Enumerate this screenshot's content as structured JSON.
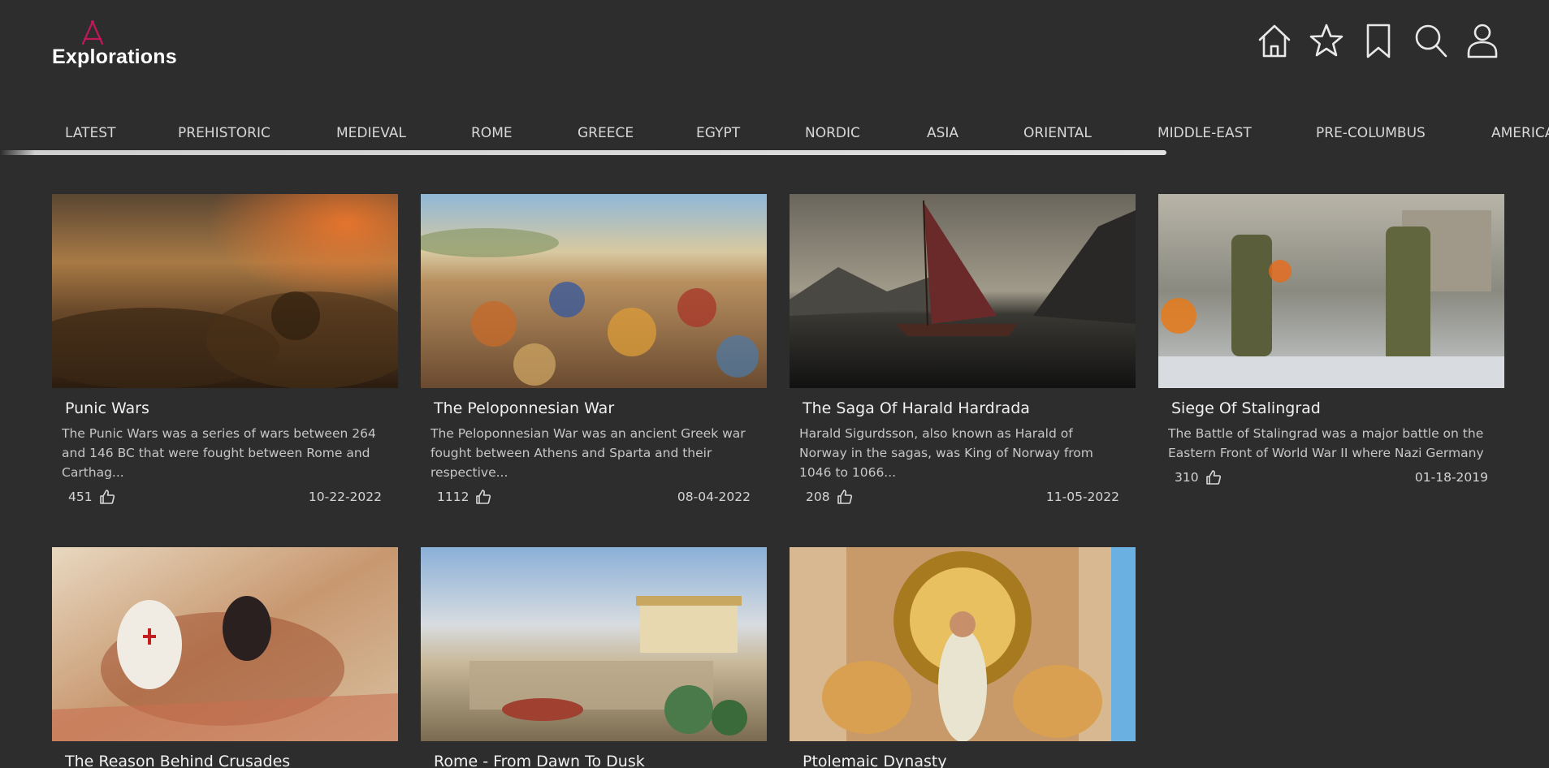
{
  "app": {
    "logo_text": "Explorations"
  },
  "header_icons": [
    "home-icon",
    "star-icon",
    "bookmark-icon",
    "search-icon",
    "user-icon"
  ],
  "nav": {
    "items": [
      "LATEST",
      "PREHISTORIC",
      "MEDIEVAL",
      "ROME",
      "GREECE",
      "EGYPT",
      "NORDIC",
      "ASIA",
      "ORIENTAL",
      "MIDDLE-EAST",
      "PRE-COLUMBUS",
      "AMERICA"
    ]
  },
  "colors": {
    "background": "#2d2d2d",
    "logo_accent": "#c2185b",
    "text": "#e6e6e6"
  },
  "articles": [
    {
      "title": "Punic Wars",
      "description": "The Punic Wars was a series of wars between 264 and 146 BC that were fought between Rome and Carthag...",
      "likes": "451",
      "date": "10-22-2022"
    },
    {
      "title": "The Peloponnesian War",
      "description": "The Peloponnesian War was an ancient Greek war fought between Athens and Sparta and their respective...",
      "likes": "1112",
      "date": "08-04-2022"
    },
    {
      "title": "The Saga Of Harald Hardrada",
      "description": "Harald Sigurdsson, also known as Harald of Norway in the sagas, was King of Norway from 1046 to 1066...",
      "likes": "208",
      "date": "11-05-2022"
    },
    {
      "title": "Siege Of Stalingrad",
      "description": "The Battle of Stalingrad was a major battle on the Eastern Front of World War II where Nazi Germany ...",
      "likes": "310",
      "date": "01-18-2019"
    },
    {
      "title": "The Reason Behind Crusades"
    },
    {
      "title": "Rome - From Dawn To Dusk"
    },
    {
      "title": "Ptolemaic Dynasty"
    }
  ]
}
